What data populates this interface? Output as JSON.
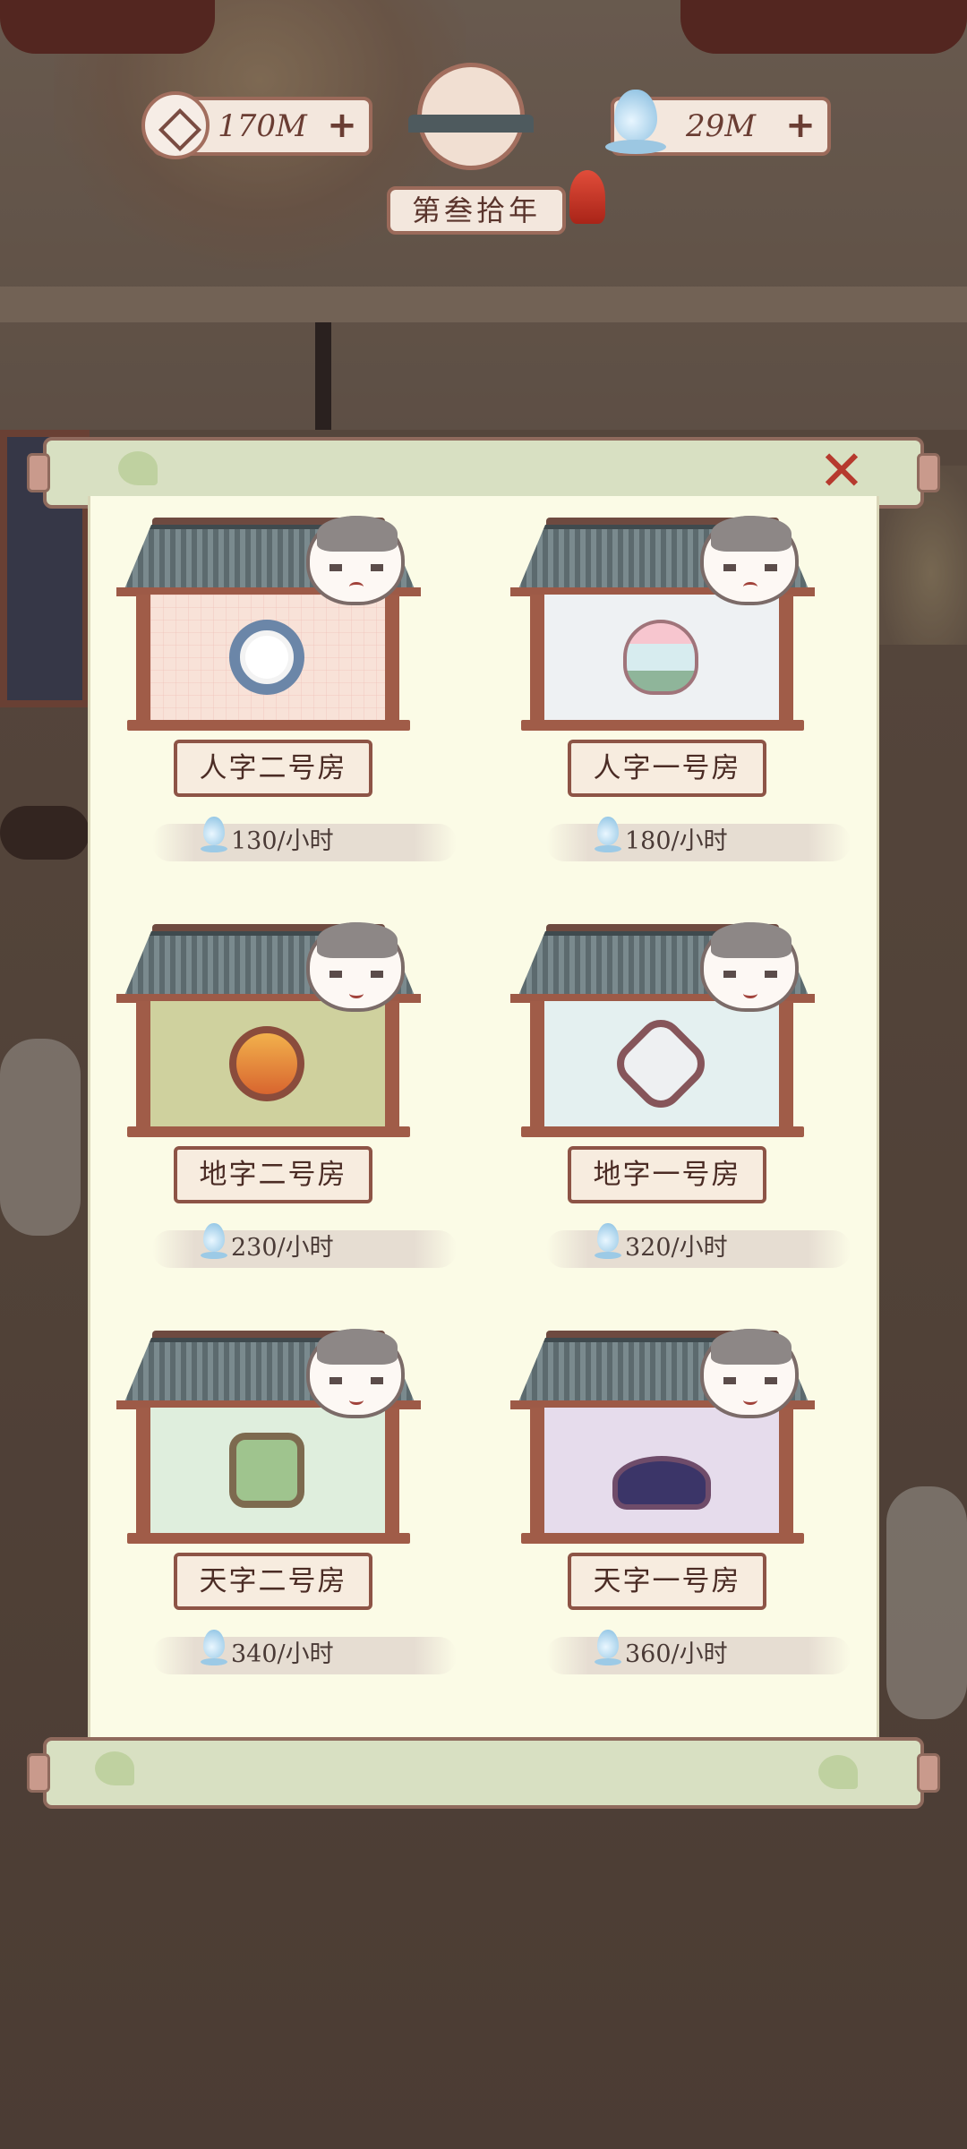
{
  "hud": {
    "coins": "170M",
    "spirit": "29M",
    "year_label": "第叁拾年"
  },
  "panel": {
    "close_symbol": "✕"
  },
  "rooms": [
    {
      "name": "人字二号房",
      "rate": "130/小时",
      "wall": "#f8e2d8",
      "mood": "grumpy"
    },
    {
      "name": "人字一号房",
      "rate": "180/小时",
      "wall": "#eef1f3",
      "mood": "grumpy"
    },
    {
      "name": "地字二号房",
      "rate": "230/小时",
      "wall": "#cfd19e",
      "mood": "happy"
    },
    {
      "name": "地字一号房",
      "rate": "320/小时",
      "wall": "#e4f0f0",
      "mood": "happy"
    },
    {
      "name": "天字二号房",
      "rate": "340/小时",
      "wall": "#dfeedd",
      "mood": "happy"
    },
    {
      "name": "天字一号房",
      "rate": "360/小时",
      "wall": "#e6dcec",
      "mood": "happy"
    }
  ]
}
